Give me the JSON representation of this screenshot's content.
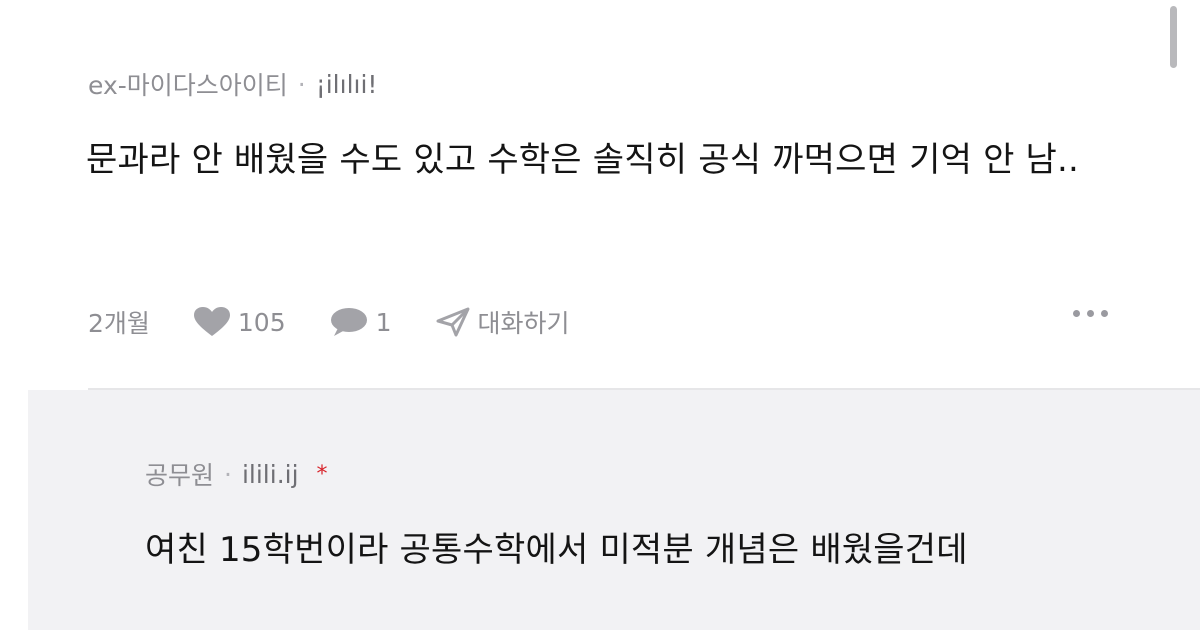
{
  "comments": [
    {
      "author": "ex-마이다스아이티",
      "separator": "·",
      "username": "¡ilılıi!",
      "text": "문과라 안 배웠을 수도 있고 수학은 솔직히 공식 까먹으면 기억 안 남..",
      "time": "2개월",
      "likes": "105",
      "replies": "1",
      "dm_label": "대화하기",
      "icons": [
        "heart-icon",
        "comment-icon",
        "send-icon",
        "more-icon"
      ]
    }
  ],
  "reply": {
    "author": "공무원",
    "separator": "·",
    "username": "ilili.ij",
    "badge": "*",
    "text": "여친 15학번이라 공통수학에서 미적분 개념은 배웠을건데"
  },
  "colors": {
    "meta_gray": "#8e8e93",
    "text": "#141414",
    "reply_bg": "#f2f2f4",
    "badge_red": "#d8232a"
  }
}
